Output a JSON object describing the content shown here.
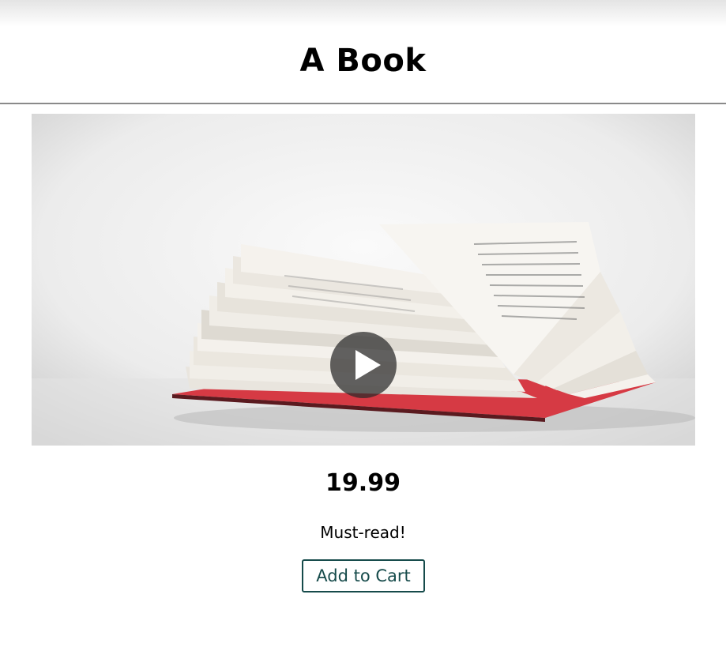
{
  "header": {
    "title": "A Book"
  },
  "media": {
    "type": "video",
    "subject": "open book",
    "play_icon": "play-icon"
  },
  "product": {
    "price": "19.99",
    "description": "Must-read!",
    "add_to_cart_label": "Add to Cart"
  },
  "colors": {
    "button_border": "#164b4b",
    "header_rule": "#8a8a8a",
    "book_cover": "#d63a44"
  }
}
